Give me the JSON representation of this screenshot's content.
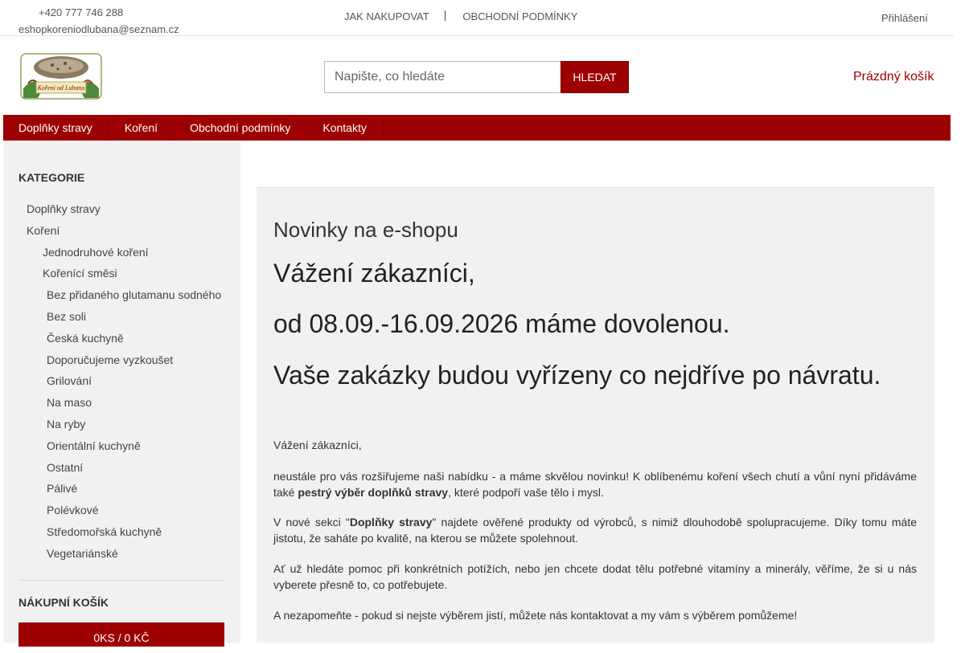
{
  "topbar": {
    "phone": "+420 777 746 288",
    "email": "eshopkoreniodlubana@seznam.cz",
    "links": [
      "JAK NAKUPOVAT",
      "OBCHODNÍ PODMÍNKY"
    ],
    "separator": "|",
    "login": "Přihlášení"
  },
  "header": {
    "logo_text": "Koření od Lubana",
    "search_placeholder": "Napište, co hledáte",
    "search_button": "HLEDAT",
    "cart_label": "Prázdný košík"
  },
  "nav": {
    "items": [
      "Doplňky stravy",
      "Koření",
      "Obchodní podmínky",
      "Kontakty"
    ]
  },
  "sidebar": {
    "categories_title": "KATEGORIE",
    "categories": [
      {
        "label": "Doplňky stravy",
        "level": 1
      },
      {
        "label": "Koření",
        "level": 1
      },
      {
        "label": "Jednodruhové koření",
        "level": 2
      },
      {
        "label": "Kořenící směsi",
        "level": 2
      },
      {
        "label": "Bez přidaného glutamanu sodného",
        "level": 3
      },
      {
        "label": "Bez soli",
        "level": 3
      },
      {
        "label": "Česká kuchyně",
        "level": 3
      },
      {
        "label": "Doporučujeme vyzkoušet",
        "level": 3
      },
      {
        "label": "Grilování",
        "level": 3
      },
      {
        "label": "Na maso",
        "level": 3
      },
      {
        "label": "Na ryby",
        "level": 3
      },
      {
        "label": "Orientální kuchyně",
        "level": 3
      },
      {
        "label": "Ostatní",
        "level": 3
      },
      {
        "label": "Pálivé",
        "level": 3
      },
      {
        "label": "Polévkové",
        "level": 3
      },
      {
        "label": "Středomořská kuchyně",
        "level": 3
      },
      {
        "label": "Vegetariánské",
        "level": 3
      }
    ],
    "cart_title": "NÁKUPNÍ KOŠÍK",
    "cart_summary": "0KS / 0 KČ"
  },
  "main": {
    "title": "Novinky na e-shopu",
    "headline_1": "Vážení zákazníci,",
    "headline_2": "od 08.09.-16.09.2026 máme dovolenou.",
    "headline_3": "Vaše zakázky budou vyřízeny co nejdříve po návratu.",
    "greeting": "Vážení zákazníci,",
    "para1_a": "neustále pro vás rozšiřujeme naši nabídku - a máme skvělou novinku! K oblíbenému koření všech chutí a vůní nyní přidáváme také ",
    "para1_b": "pestrý výběr doplňků stravy",
    "para1_c": ", které podpoří vaše tělo i mysl.",
    "para2_a": "V nové sekci \"",
    "para2_b": "Doplňky stravy",
    "para2_c": "\" najdete ověřené produkty od výrobců, s nimiž dlouhodobě spolupracujeme. Díky tomu máte jistotu, že saháte po kvalitě, na kterou se můžete spolehnout.",
    "para3": "Ať už hledáte pomoc při konkrétních potížích, nebo jen chcete dodat tělu potřebné vitamíny a minerály, věříme, že si u nás vyberete přesně to, co potřebujete.",
    "para4": "A nezapomeňte - pokud si nejste výběrem jistí, můžete nás kontaktovat a my vám s výběrem pomůžeme!"
  },
  "colors": {
    "accent": "#9d0000",
    "panel": "#f1f1f1"
  }
}
